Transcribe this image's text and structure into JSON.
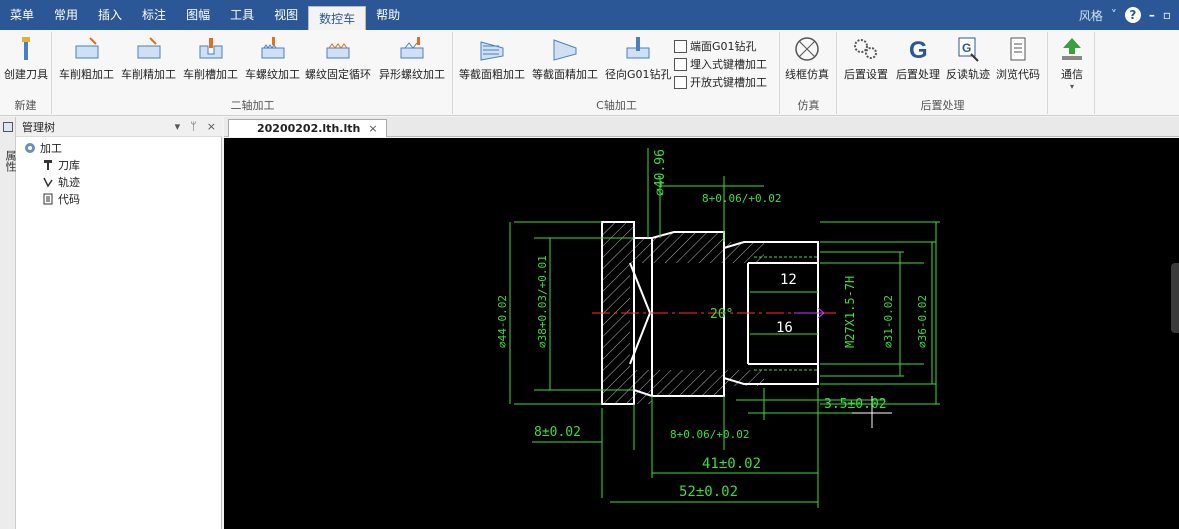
{
  "menu": [
    "菜单",
    "常用",
    "插入",
    "标注",
    "图幅",
    "工具",
    "视图",
    "数控车",
    "帮助"
  ],
  "menubar_right": {
    "style_label": "风格",
    "help": "?"
  },
  "ribbon": {
    "groups": {
      "new": "新建",
      "two_axis": "二轴加工",
      "c_axis": "C轴加工",
      "sim": "仿真",
      "post": "后置处理"
    },
    "tools": {
      "create_tool": "创建刀具",
      "rough_turn": "车削粗加工",
      "finish_turn": "车削精加工",
      "groove_turn": "车削槽加工",
      "thread_turn": "车螺纹加工",
      "thread_cycle": "螺纹固定循环",
      "special_thread": "异形螺纹加工",
      "equal_rough": "等截面粗加工",
      "equal_finish": "等截面精加工",
      "radial_drill": "径向G01钻孔",
      "face_drill": "端面G01钻孔",
      "embed_keyway": "埋入式键槽加工",
      "open_keyway": "开放式键槽加工",
      "wire_sim": "线框仿真",
      "post_settings": "后置设置",
      "post_process": "后置处理",
      "reverse_path": "反读轨迹",
      "browse_code": "浏览代码",
      "comm": "通信"
    }
  },
  "tree": {
    "title": "管理树",
    "root": "加工",
    "children": [
      "刀库",
      "轨迹",
      "代码"
    ],
    "side_label": "属性"
  },
  "doc_tab": {
    "name": "20200202.lth.lth"
  },
  "drawing": {
    "dims": {
      "d40": "⌀40.96",
      "len8_top": "8+0.06/+0.02",
      "d44": "⌀44-0.02",
      "d38": "⌀38+0.03/+0.01",
      "d31": "⌀31-0.02",
      "d36": "⌀36-0.02",
      "thread": "M27X1.5-7H",
      "l12": "12",
      "l16": "16",
      "angle": "20°",
      "l8_left": "8±0.02",
      "l8_bottom": "8+0.06/+0.02",
      "l3_5": "3.5±0.02",
      "l41": "41±0.02",
      "l52": "52±0.02"
    }
  },
  "colors": {
    "menubar": "#2b5797",
    "canvas_bg": "#000000",
    "part_line": "#ffffff",
    "dim_line": "#3cdc3c",
    "center_line": "#ff3030"
  }
}
